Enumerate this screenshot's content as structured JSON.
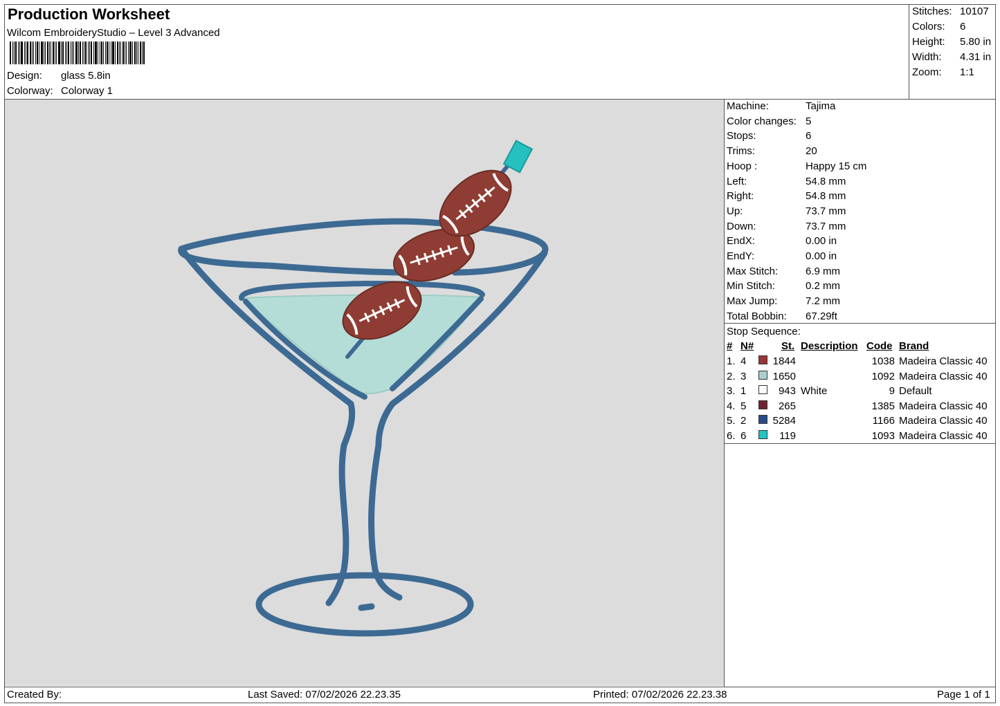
{
  "header": {
    "title": "Production Worksheet",
    "subtitle": "Wilcom EmbroideryStudio – Level 3 Advanced",
    "design_label": "Design:",
    "design_value": "glass 5.8in",
    "colorway_label": "Colorway:",
    "colorway_value": "Colorway 1"
  },
  "summary": [
    {
      "label": "Stitches:",
      "value": "10107"
    },
    {
      "label": "Colors:",
      "value": "6"
    },
    {
      "label": "Height:",
      "value": "5.80 in"
    },
    {
      "label": "Width:",
      "value": "4.31 in"
    },
    {
      "label": "Zoom:",
      "value": "1:1"
    }
  ],
  "machine_info": [
    {
      "label": "Machine:",
      "value": "Tajima"
    },
    {
      "label": "Color changes:",
      "value": "5"
    },
    {
      "label": "Stops:",
      "value": "6"
    },
    {
      "label": "Trims:",
      "value": "20"
    },
    {
      "label": "Hoop :",
      "value": "Happy 15 cm"
    },
    {
      "label": "Left:",
      "value": "54.8 mm"
    },
    {
      "label": "Right:",
      "value": "54.8 mm"
    },
    {
      "label": "Up:",
      "value": "73.7 mm"
    },
    {
      "label": "Down:",
      "value": "73.7 mm"
    },
    {
      "label": "EndX:",
      "value": "0.00 in"
    },
    {
      "label": "EndY:",
      "value": "0.00 in"
    },
    {
      "label": "Max Stitch:",
      "value": "6.9 mm"
    },
    {
      "label": "Min Stitch:",
      "value": "0.2 mm"
    },
    {
      "label": "Max Jump:",
      "value": "7.2 mm"
    },
    {
      "label": "Total Bobbin:",
      "value": "67.29ft"
    }
  ],
  "stop_sequence": {
    "title": "Stop Sequence:",
    "headers": {
      "num": "#",
      "n": "N#",
      "st": "St.",
      "description": "Description",
      "code": "Code",
      "brand": "Brand"
    },
    "rows": [
      {
        "num": "1.",
        "n": "4",
        "color": "#9b3535",
        "st": "1844",
        "description": "",
        "code": "1038",
        "brand": "Madeira Classic 40"
      },
      {
        "num": "2.",
        "n": "3",
        "color": "#a9cfcf",
        "st": "1650",
        "description": "",
        "code": "1092",
        "brand": "Madeira Classic 40"
      },
      {
        "num": "3.",
        "n": "1",
        "color": "#ffffff",
        "st": "943",
        "description": "White",
        "code": "9",
        "brand": "Default"
      },
      {
        "num": "4.",
        "n": "5",
        "color": "#6e2530",
        "st": "265",
        "description": "",
        "code": "1385",
        "brand": "Madeira Classic 40"
      },
      {
        "num": "5.",
        "n": "2",
        "color": "#274b8a",
        "st": "5284",
        "description": "",
        "code": "1166",
        "brand": "Madeira Classic 40"
      },
      {
        "num": "6.",
        "n": "6",
        "color": "#22c4c4",
        "st": "119",
        "description": "",
        "code": "1093",
        "brand": "Madeira Classic 40"
      }
    ]
  },
  "footer": {
    "created_by": "Created By:",
    "last_saved": "Last Saved: 07/02/2026 22.23.35",
    "printed": "Printed: 07/02/2026 22.23.38",
    "page": "Page 1 of 1"
  },
  "colors": {
    "glass_outline": "#3d6a93",
    "liquid": "#b4ddd7",
    "football": "#8f3d34",
    "cap": "#25c0c0",
    "canvas": "#dcdcdc"
  }
}
